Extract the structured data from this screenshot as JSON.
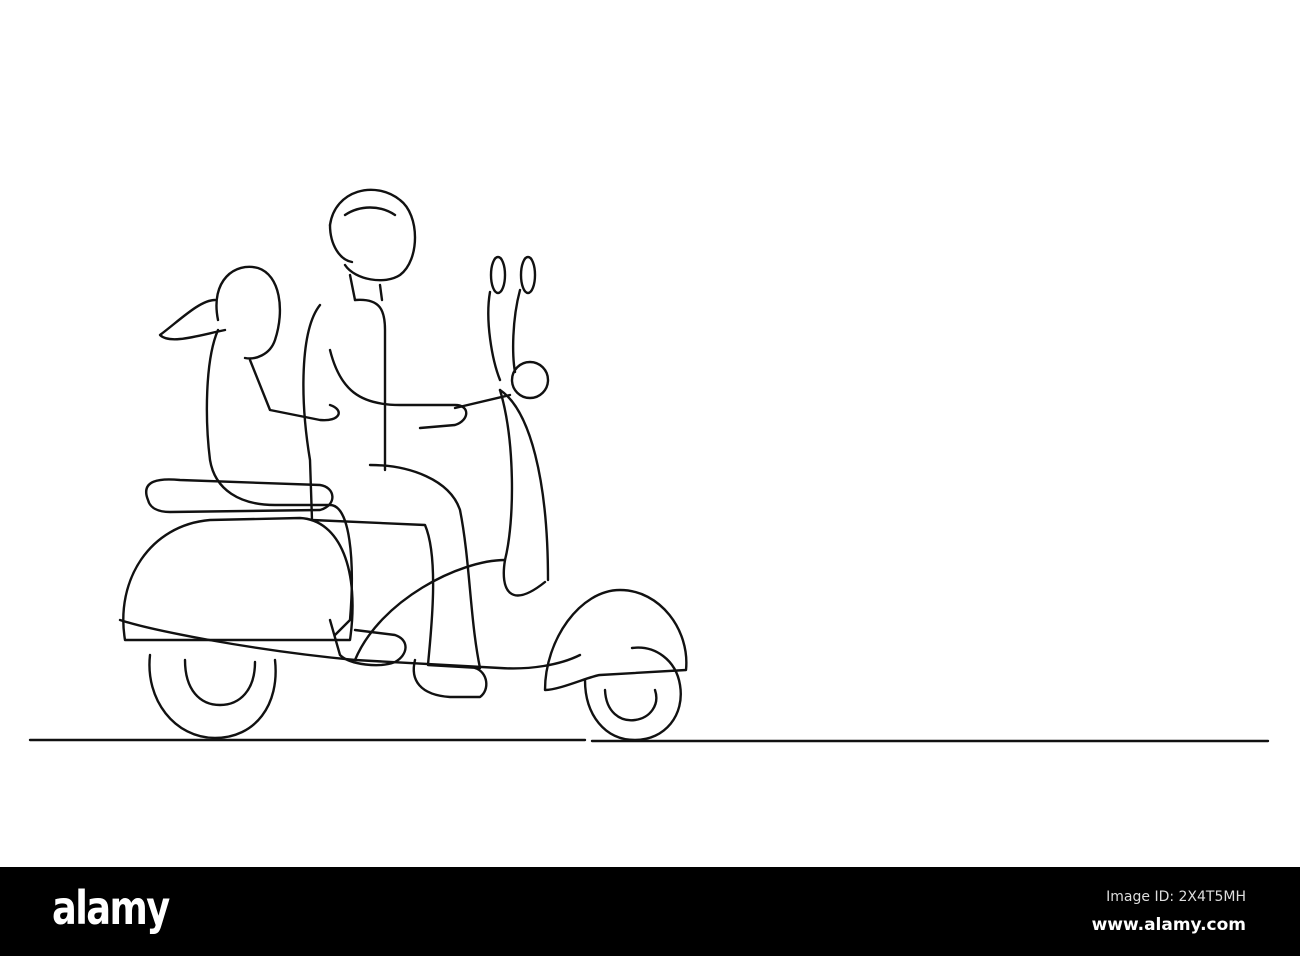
{
  "watermark": {
    "logo": "alamy",
    "image_id": "Image ID: 2X4T5MH",
    "website": "www.alamy.com"
  },
  "colors": {
    "line": "#111111",
    "background": "#ffffff",
    "bar": "#000000"
  }
}
